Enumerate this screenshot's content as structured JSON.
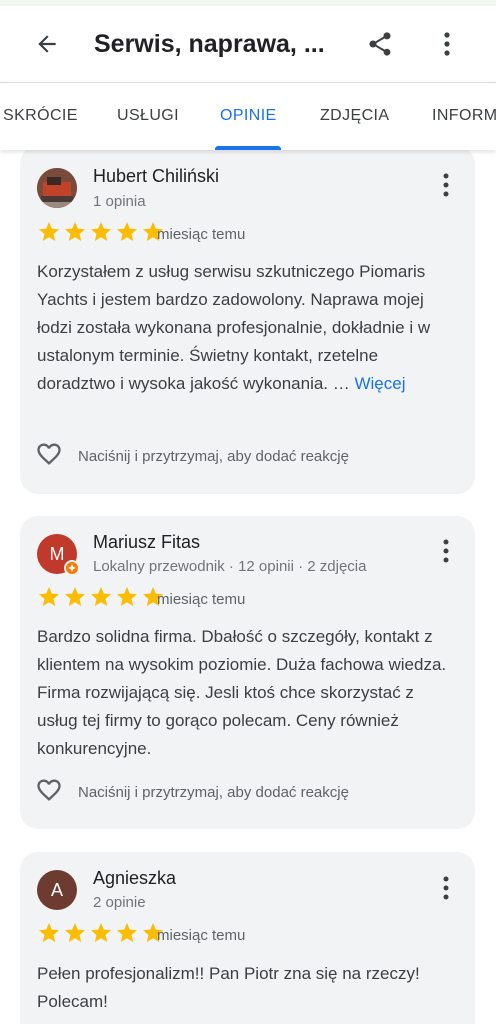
{
  "header": {
    "title": "Serwis, naprawa, ..."
  },
  "tabs": [
    {
      "label": "SKRÓCIE"
    },
    {
      "label": "USŁUGI"
    },
    {
      "label": "OPINIE"
    },
    {
      "label": "ZDJĘCIA"
    },
    {
      "label": "INFORM"
    }
  ],
  "reviews": [
    {
      "name": "Hubert Chiliński",
      "meta": "1 opinia",
      "rating": 5,
      "when": "miesiąc temu",
      "text": "Korzystałem z usług serwisu szkutniczego Piomaris Yachts i jestem bardzo zadowolony. Naprawa mojej łodzi została wykonana profesjonalnie, dokładnie i w ustalonym terminie. Świetny kontakt, rzetelne doradztwo i wysoka jakość wykonania. …",
      "more": "Więcej",
      "reaction": "Naciśnij i przytrzymaj, aby dodać reakcję"
    },
    {
      "name": "Mariusz Fitas",
      "initial": "M",
      "meta": "Lokalny przewodnik · 12 opinii · 2 zdjęcia",
      "rating": 5,
      "when": "miesiąc temu",
      "text": "Bardzo solidna firma. Dbałość o szczegóły, kontakt z klientem na wysokim poziomie. Duża fachowa wiedza. Firma rozwijającą się. Jesli ktoś chce skorzystać z usług tej firmy to gorąco polecam. Ceny również konkurencyjne.",
      "reaction": "Naciśnij i przytrzymaj, aby dodać reakcję"
    },
    {
      "name": "Agnieszka",
      "initial": "A",
      "meta": "2 opinie",
      "rating": 5,
      "when": "miesiąc temu",
      "text": "Pełen profesjonalizm!! Pan Piotr zna się na rzeczy! Polecam!"
    }
  ],
  "colors": {
    "accent": "#1a73e8",
    "star": "#fbbc04",
    "card_bg": "#f1f3f4",
    "avatar_m": "#c0392b",
    "avatar_a": "#6d3b2f"
  },
  "icons": [
    "back-arrow-icon",
    "share-icon",
    "more-vert-icon",
    "star-icon",
    "heart-outline-icon",
    "local-guide-badge-icon"
  ]
}
